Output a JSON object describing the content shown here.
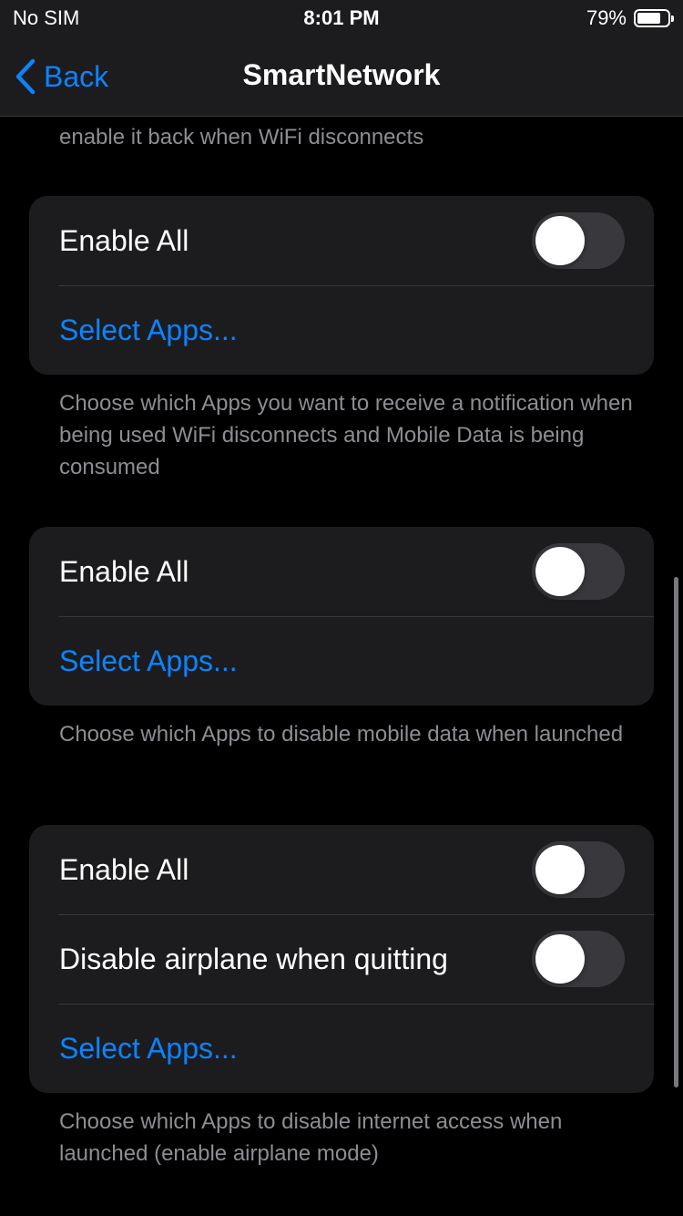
{
  "status_bar": {
    "carrier": "No SIM",
    "time": "8:01 PM",
    "battery_percent": "79%",
    "battery_level": 0.79
  },
  "nav": {
    "back_label": "Back",
    "back_icon": "chevron-left-icon",
    "title": "SmartNetwork"
  },
  "colors": {
    "background": "#000000",
    "cell_background": "#1c1c1e",
    "accent": "#0a84ff",
    "separator": "#38383a",
    "secondary_text": "#8d8d93",
    "toggle_off": "#39393d"
  },
  "top_footer": "enable it back when WiFi disconnects",
  "sections": [
    {
      "rows": [
        {
          "label": "Enable All",
          "toggle_on": false
        },
        {
          "label": "Select Apps..."
        }
      ],
      "footer": "Choose which Apps you want to receive a notification when being used WiFi disconnects and Mobile Data is being consumed"
    },
    {
      "rows": [
        {
          "label": "Enable All",
          "toggle_on": false
        },
        {
          "label": "Select Apps..."
        }
      ],
      "footer": "Choose which Apps to disable mobile data when launched"
    },
    {
      "rows": [
        {
          "label": "Enable All",
          "toggle_on": false
        },
        {
          "label": "Disable airplane when quitting",
          "toggle_on": false
        },
        {
          "label": "Select Apps..."
        }
      ],
      "footer": "Choose which Apps to disable internet access when launched (enable airplane mode)"
    }
  ]
}
